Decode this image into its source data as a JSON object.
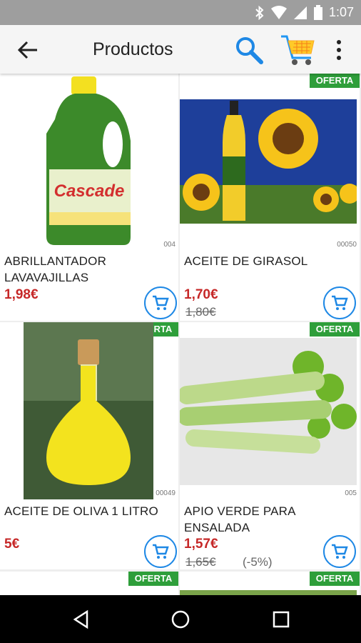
{
  "status_bar": {
    "time": "1:07"
  },
  "app_bar": {
    "title": "Productos"
  },
  "badge_label": "OFERTA",
  "products": [
    {
      "name": "ABRILLANTADOR LAVAVAJILLAS",
      "code": "004",
      "price": "1,98€",
      "old_price": "",
      "discount": "",
      "offer": false,
      "image": "dish-detergent-bottle"
    },
    {
      "name": "ACEITE DE GIRASOL",
      "code": "00050",
      "price": "1,70€",
      "old_price": "1,80€",
      "discount": "",
      "offer": true,
      "image": "sunflower-oil-bottle"
    },
    {
      "name": "ACEITE DE OLIVA 1 LITRO",
      "code": "00049",
      "price": "5€",
      "old_price": "",
      "discount": "",
      "offer": true,
      "image": "olive-oil-decanter"
    },
    {
      "name": "APIO VERDE PARA ENSALADA",
      "code": "005",
      "price": "1,57€",
      "old_price": "1,65€",
      "discount": "(-5%)",
      "offer": true,
      "image": "celery"
    }
  ],
  "colors": {
    "offer_badge": "#2e9e3a",
    "price": "#c62828",
    "cart_button": "#1e88e5",
    "app_bar": "#f5f5f5",
    "status_bar": "#9e9e9e"
  }
}
